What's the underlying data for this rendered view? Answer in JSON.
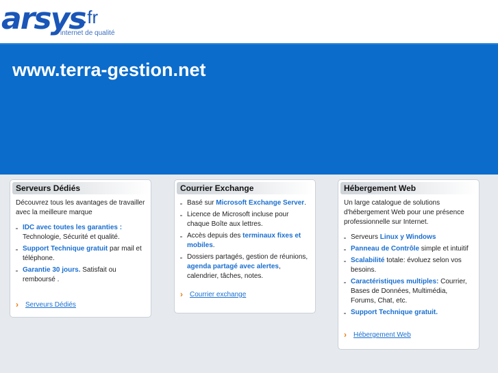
{
  "logo": {
    "brand": "arsys",
    "tld": ".fr",
    "tagline": "internet de qualité"
  },
  "hero": {
    "title": "www.terra-gestion.net"
  },
  "cards": [
    {
      "title": "Serveurs Dédiés",
      "intro": "Découvrez tous les avantages de travailler avec la meilleure marque",
      "items": [
        {
          "bold": "IDC avec toutes les garanties :",
          "text": " Technologie, Sécurité et qualité."
        },
        {
          "bold": "Support Technique gratuit",
          "text": " par mail et téléphone."
        },
        {
          "bold": "Garantie 30 jours.",
          "text": " Satisfait ou remboursé ."
        }
      ],
      "link": "Serveurs Dédiés"
    },
    {
      "title": "Courrier Exchange",
      "items": [
        {
          "pre": "Basé sur ",
          "bold": "Microsoft Exchange Server",
          "text": "."
        },
        {
          "pre": "Licence de Microsoft incluse pour chaque Boîte aux lettres.",
          "bold": "",
          "text": ""
        },
        {
          "pre": "Accès depuis des ",
          "bold": "terminaux fixes et mobiles",
          "text": "."
        },
        {
          "pre": "Dossiers partagés, gestion de réunions, ",
          "bold": "agenda partagé avec alertes",
          "text": ", calendrier, tâches, notes."
        }
      ],
      "link": "Courrier exchange"
    },
    {
      "title": "Hébergement Web",
      "intro": "Un large catalogue de solutions d'hébergement Web pour une présence professionnelle sur Internet.",
      "items": [
        {
          "pre": "Serveurs ",
          "bold": "Linux y Windows",
          "text": ""
        },
        {
          "pre": "",
          "bold": "Panneau de Contrôle",
          "text": " simple et intuitif"
        },
        {
          "pre": "",
          "bold": "Scalabilité",
          "text": " totale: évoluez selon vos besoins."
        },
        {
          "pre": "",
          "bold": "Caractéristiques multiples:",
          "text": " Courrier, Bases de Données, Multimédia, Forums, Chat, etc."
        },
        {
          "pre": "",
          "bold": "Support Technique gratuit.",
          "text": ""
        }
      ],
      "link": "Hébergement Web"
    }
  ]
}
